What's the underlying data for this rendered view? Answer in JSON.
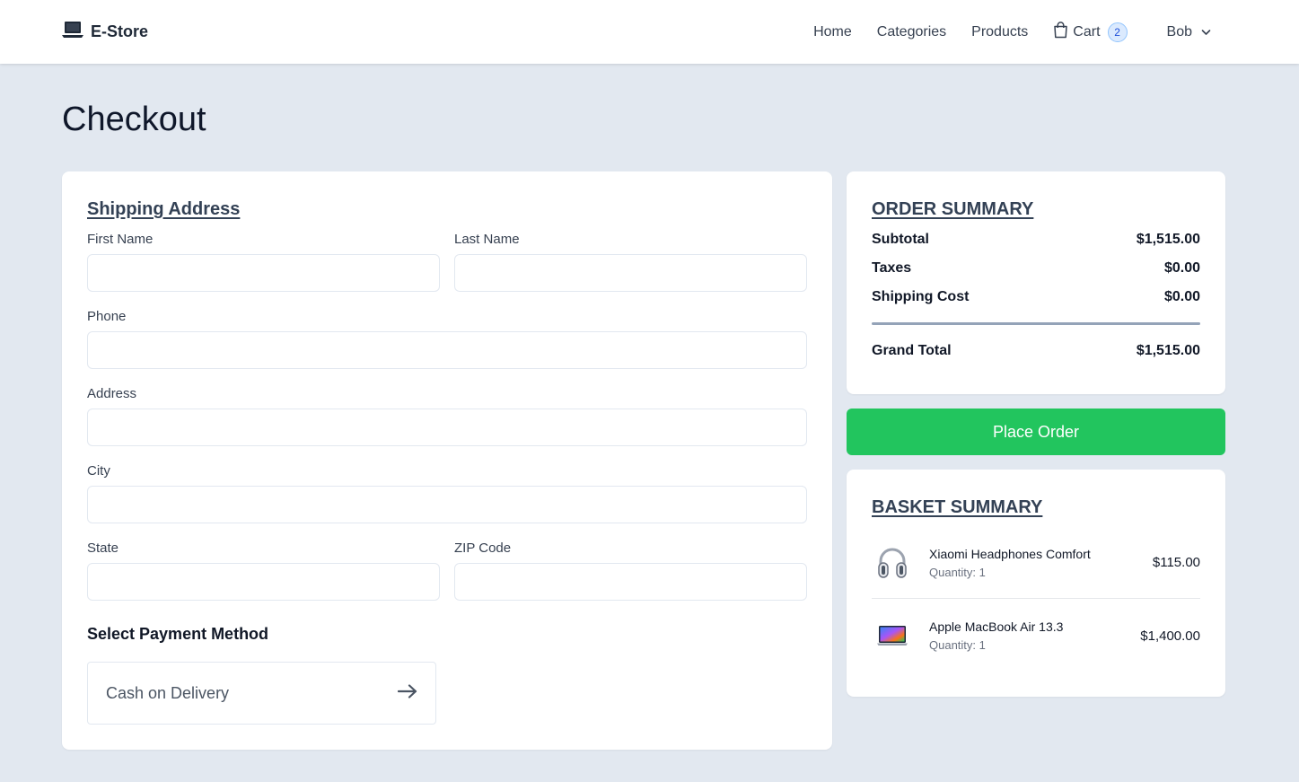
{
  "nav": {
    "brand": "E-Store",
    "links": [
      "Home",
      "Categories",
      "Products"
    ],
    "cart_label": "Cart",
    "cart_count": "2",
    "user_name": "Bob"
  },
  "page": {
    "title": "Checkout"
  },
  "shipping": {
    "heading": "Shipping Address",
    "fields": {
      "first_name": {
        "label": "First Name",
        "value": ""
      },
      "last_name": {
        "label": "Last Name",
        "value": ""
      },
      "phone": {
        "label": "Phone",
        "value": ""
      },
      "address": {
        "label": "Address",
        "value": ""
      },
      "city": {
        "label": "City",
        "value": ""
      },
      "state": {
        "label": "State",
        "value": ""
      },
      "zip": {
        "label": "ZIP Code",
        "value": ""
      }
    },
    "payment_heading": "Select Payment Method",
    "payment_option": "Cash on Delivery"
  },
  "order_summary": {
    "heading": "ORDER SUMMARY",
    "rows": [
      {
        "label": "Subtotal",
        "value": "$1,515.00"
      },
      {
        "label": "Taxes",
        "value": "$0.00"
      },
      {
        "label": "Shipping Cost",
        "value": "$0.00"
      }
    ],
    "grand_total_label": "Grand Total",
    "grand_total_value": "$1,515.00",
    "place_order_label": "Place Order"
  },
  "basket": {
    "heading": "BASKET SUMMARY",
    "items": [
      {
        "name": "Xiaomi Headphones Comfort",
        "quantity": "Quantity: 1",
        "price": "$115.00",
        "thumb": "headphones-image"
      },
      {
        "name": "Apple MacBook Air 13.3",
        "quantity": "Quantity: 1",
        "price": "$1,400.00",
        "thumb": "laptop-image"
      }
    ]
  },
  "colors": {
    "background": "#e2e8f0",
    "accent_green": "#22c55e",
    "heading_slate": "#334155",
    "badge_blue": "#dbeafe"
  }
}
